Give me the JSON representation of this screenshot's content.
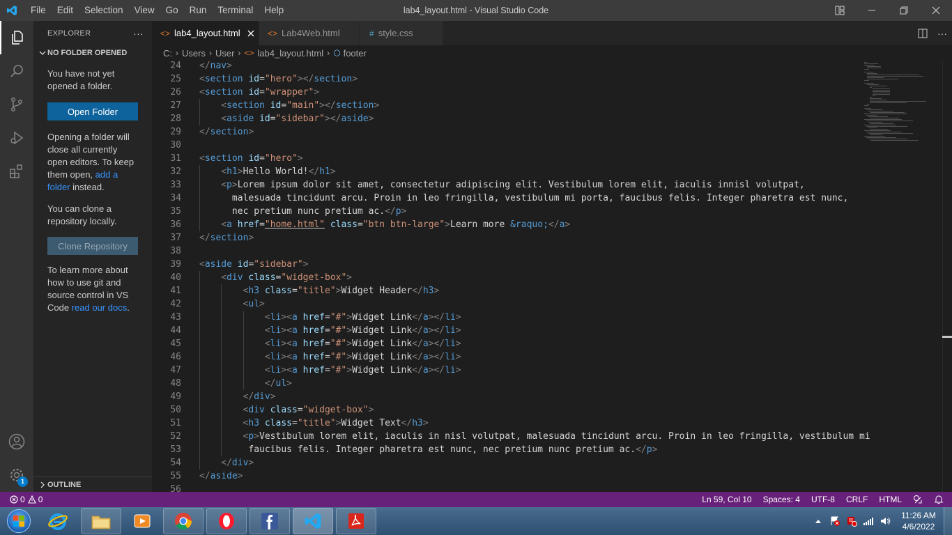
{
  "window": {
    "title": "lab4_layout.html - Visual Studio Code",
    "menu": [
      "File",
      "Edit",
      "Selection",
      "View",
      "Go",
      "Run",
      "Terminal",
      "Help"
    ]
  },
  "activity_bar": {
    "items": [
      "explorer-icon",
      "search-icon",
      "source-control-icon",
      "run-debug-icon",
      "extensions-icon",
      "account-icon",
      "settings-gear-icon"
    ],
    "settings_badge": "1"
  },
  "sidebar": {
    "title": "EXPLORER",
    "more": "···",
    "section": "NO FOLDER OPENED",
    "no_folder_text": "You have not yet opened a folder.",
    "open_folder_button": "Open Folder",
    "opening_text_before": "Opening a folder will close all currently open editors. To keep them open, ",
    "add_folder_link": "add a folder",
    "opening_text_after": " instead.",
    "clone_text": "You can clone a repository locally.",
    "clone_button": "Clone Repository",
    "learn_text": "To learn more about how to use git and source control in VS Code ",
    "docs_link": "read our docs",
    "learn_text_end": ".",
    "outline": "OUTLINE"
  },
  "tabs": [
    {
      "label": "lab4_layout.html",
      "icon": "html-icon",
      "active": true
    },
    {
      "label": "Lab4Web.html",
      "icon": "html-icon",
      "active": false
    },
    {
      "label": "style.css",
      "icon": "css-icon",
      "active": false
    }
  ],
  "breadcrumb": [
    "C:",
    "Users",
    "User",
    "lab4_layout.html",
    "footer"
  ],
  "editor": {
    "lines": [
      {
        "n": "24",
        "indent": 0,
        "tokens": [
          [
            "b",
            "</"
          ],
          [
            "t",
            "nav"
          ],
          [
            "b",
            ">"
          ]
        ]
      },
      {
        "n": "25",
        "indent": 0,
        "tokens": [
          [
            "b",
            "<"
          ],
          [
            "t",
            "section"
          ],
          [
            "p",
            " "
          ],
          [
            "a",
            "id"
          ],
          [
            "p",
            "="
          ],
          [
            "s",
            "\"hero\""
          ],
          [
            "b",
            "></"
          ],
          [
            "t",
            "section"
          ],
          [
            "b",
            ">"
          ]
        ]
      },
      {
        "n": "26",
        "indent": 0,
        "tokens": [
          [
            "b",
            "<"
          ],
          [
            "t",
            "section"
          ],
          [
            "p",
            " "
          ],
          [
            "a",
            "id"
          ],
          [
            "p",
            "="
          ],
          [
            "s",
            "\"wrapper\""
          ],
          [
            "b",
            ">"
          ]
        ]
      },
      {
        "n": "27",
        "indent": 1,
        "tokens": [
          [
            "b",
            "<"
          ],
          [
            "t",
            "section"
          ],
          [
            "p",
            " "
          ],
          [
            "a",
            "id"
          ],
          [
            "p",
            "="
          ],
          [
            "s",
            "\"main\""
          ],
          [
            "b",
            "></"
          ],
          [
            "t",
            "section"
          ],
          [
            "b",
            ">"
          ]
        ]
      },
      {
        "n": "28",
        "indent": 1,
        "tokens": [
          [
            "b",
            "<"
          ],
          [
            "t",
            "aside"
          ],
          [
            "p",
            " "
          ],
          [
            "a",
            "id"
          ],
          [
            "p",
            "="
          ],
          [
            "s",
            "\"sidebar\""
          ],
          [
            "b",
            "></"
          ],
          [
            "t",
            "aside"
          ],
          [
            "b",
            ">"
          ]
        ]
      },
      {
        "n": "29",
        "indent": 0,
        "tokens": [
          [
            "b",
            "</"
          ],
          [
            "t",
            "section"
          ],
          [
            "b",
            ">"
          ]
        ]
      },
      {
        "n": "30",
        "indent": 0,
        "tokens": []
      },
      {
        "n": "31",
        "indent": 0,
        "tokens": [
          [
            "b",
            "<"
          ],
          [
            "t",
            "section"
          ],
          [
            "p",
            " "
          ],
          [
            "a",
            "id"
          ],
          [
            "p",
            "="
          ],
          [
            "s",
            "\"hero\""
          ],
          [
            "b",
            ">"
          ]
        ]
      },
      {
        "n": "32",
        "indent": 1,
        "tokens": [
          [
            "b",
            "<"
          ],
          [
            "t",
            "h1"
          ],
          [
            "b",
            ">"
          ],
          [
            "p",
            "Hello World!"
          ],
          [
            "b",
            "</"
          ],
          [
            "t",
            "h1"
          ],
          [
            "b",
            ">"
          ]
        ]
      },
      {
        "n": "33",
        "indent": 1,
        "tokens": [
          [
            "b",
            "<"
          ],
          [
            "t",
            "p"
          ],
          [
            "b",
            ">"
          ],
          [
            "p",
            "Lorem ipsum dolor sit amet, consectetur adipiscing elit. Vestibulum lorem elit, iaculis innisl volutpat,"
          ]
        ]
      },
      {
        "n": "34",
        "indent": 1,
        "tokens": [
          [
            "p",
            "  malesuada tincidunt arcu. Proin in leo fringilla, vestibulum mi porta, faucibus felis. Integer pharetra est nunc,"
          ]
        ]
      },
      {
        "n": "35",
        "indent": 1,
        "tokens": [
          [
            "p",
            "  nec pretium nunc pretium ac."
          ],
          [
            "b",
            "</"
          ],
          [
            "t",
            "p"
          ],
          [
            "b",
            ">"
          ]
        ]
      },
      {
        "n": "36",
        "indent": 1,
        "tokens": [
          [
            "b",
            "<"
          ],
          [
            "t",
            "a"
          ],
          [
            "p",
            " "
          ],
          [
            "a",
            "href"
          ],
          [
            "p",
            "="
          ],
          [
            "su",
            "\"home.html\""
          ],
          [
            "p",
            " "
          ],
          [
            "a",
            "class"
          ],
          [
            "p",
            "="
          ],
          [
            "s",
            "\"btn btn-large\""
          ],
          [
            "b",
            ">"
          ],
          [
            "p",
            "Learn more "
          ],
          [
            "e",
            "&raquo;"
          ],
          [
            "b",
            "</"
          ],
          [
            "t",
            "a"
          ],
          [
            "b",
            ">"
          ]
        ]
      },
      {
        "n": "37",
        "indent": 0,
        "tokens": [
          [
            "b",
            "</"
          ],
          [
            "t",
            "section"
          ],
          [
            "b",
            ">"
          ]
        ]
      },
      {
        "n": "38",
        "indent": 0,
        "tokens": []
      },
      {
        "n": "39",
        "indent": 0,
        "tokens": [
          [
            "b",
            "<"
          ],
          [
            "t",
            "aside"
          ],
          [
            "p",
            " "
          ],
          [
            "a",
            "id"
          ],
          [
            "p",
            "="
          ],
          [
            "s",
            "\"sidebar\""
          ],
          [
            "b",
            ">"
          ]
        ]
      },
      {
        "n": "40",
        "indent": 1,
        "tokens": [
          [
            "b",
            "<"
          ],
          [
            "t",
            "div"
          ],
          [
            "p",
            " "
          ],
          [
            "a",
            "class"
          ],
          [
            "p",
            "="
          ],
          [
            "s",
            "\"widget-box\""
          ],
          [
            "b",
            ">"
          ]
        ]
      },
      {
        "n": "41",
        "indent": 2,
        "tokens": [
          [
            "b",
            "<"
          ],
          [
            "t",
            "h3"
          ],
          [
            "p",
            " "
          ],
          [
            "a",
            "class"
          ],
          [
            "p",
            "="
          ],
          [
            "s",
            "\"title\""
          ],
          [
            "b",
            ">"
          ],
          [
            "p",
            "Widget Header"
          ],
          [
            "b",
            "</"
          ],
          [
            "t",
            "h3"
          ],
          [
            "b",
            ">"
          ]
        ]
      },
      {
        "n": "42",
        "indent": 2,
        "tokens": [
          [
            "b",
            "<"
          ],
          [
            "t",
            "ul"
          ],
          [
            "b",
            ">"
          ]
        ]
      },
      {
        "n": "43",
        "indent": 3,
        "tokens": [
          [
            "b",
            "<"
          ],
          [
            "t",
            "li"
          ],
          [
            "b",
            "><"
          ],
          [
            "t",
            "a"
          ],
          [
            "p",
            " "
          ],
          [
            "a",
            "href"
          ],
          [
            "p",
            "="
          ],
          [
            "s",
            "\"#\""
          ],
          [
            "b",
            ">"
          ],
          [
            "p",
            "Widget Link"
          ],
          [
            "b",
            "</"
          ],
          [
            "t",
            "a"
          ],
          [
            "b",
            "></"
          ],
          [
            "t",
            "li"
          ],
          [
            "b",
            ">"
          ]
        ]
      },
      {
        "n": "44",
        "indent": 3,
        "tokens": [
          [
            "b",
            "<"
          ],
          [
            "t",
            "li"
          ],
          [
            "b",
            "><"
          ],
          [
            "t",
            "a"
          ],
          [
            "p",
            " "
          ],
          [
            "a",
            "href"
          ],
          [
            "p",
            "="
          ],
          [
            "s",
            "\"#\""
          ],
          [
            "b",
            ">"
          ],
          [
            "p",
            "Widget Link"
          ],
          [
            "b",
            "</"
          ],
          [
            "t",
            "a"
          ],
          [
            "b",
            "></"
          ],
          [
            "t",
            "li"
          ],
          [
            "b",
            ">"
          ]
        ]
      },
      {
        "n": "45",
        "indent": 3,
        "tokens": [
          [
            "b",
            "<"
          ],
          [
            "t",
            "li"
          ],
          [
            "b",
            "><"
          ],
          [
            "t",
            "a"
          ],
          [
            "p",
            " "
          ],
          [
            "a",
            "href"
          ],
          [
            "p",
            "="
          ],
          [
            "s",
            "\"#\""
          ],
          [
            "b",
            ">"
          ],
          [
            "p",
            "Widget Link"
          ],
          [
            "b",
            "</"
          ],
          [
            "t",
            "a"
          ],
          [
            "b",
            "></"
          ],
          [
            "t",
            "li"
          ],
          [
            "b",
            ">"
          ]
        ]
      },
      {
        "n": "46",
        "indent": 3,
        "tokens": [
          [
            "b",
            "<"
          ],
          [
            "t",
            "li"
          ],
          [
            "b",
            "><"
          ],
          [
            "t",
            "a"
          ],
          [
            "p",
            " "
          ],
          [
            "a",
            "href"
          ],
          [
            "p",
            "="
          ],
          [
            "s",
            "\"#\""
          ],
          [
            "b",
            ">"
          ],
          [
            "p",
            "Widget Link"
          ],
          [
            "b",
            "</"
          ],
          [
            "t",
            "a"
          ],
          [
            "b",
            "></"
          ],
          [
            "t",
            "li"
          ],
          [
            "b",
            ">"
          ]
        ]
      },
      {
        "n": "47",
        "indent": 3,
        "tokens": [
          [
            "b",
            "<"
          ],
          [
            "t",
            "li"
          ],
          [
            "b",
            "><"
          ],
          [
            "t",
            "a"
          ],
          [
            "p",
            " "
          ],
          [
            "a",
            "href"
          ],
          [
            "p",
            "="
          ],
          [
            "s",
            "\"#\""
          ],
          [
            "b",
            ">"
          ],
          [
            "p",
            "Widget Link"
          ],
          [
            "b",
            "</"
          ],
          [
            "t",
            "a"
          ],
          [
            "b",
            "></"
          ],
          [
            "t",
            "li"
          ],
          [
            "b",
            ">"
          ]
        ]
      },
      {
        "n": "48",
        "indent": 3,
        "tokens": [
          [
            "b",
            "</"
          ],
          [
            "t",
            "ul"
          ],
          [
            "b",
            ">"
          ]
        ]
      },
      {
        "n": "49",
        "indent": 2,
        "tokens": [
          [
            "b",
            "</"
          ],
          [
            "t",
            "div"
          ],
          [
            "b",
            ">"
          ]
        ]
      },
      {
        "n": "50",
        "indent": 2,
        "tokens": [
          [
            "b",
            "<"
          ],
          [
            "t",
            "div"
          ],
          [
            "p",
            " "
          ],
          [
            "a",
            "class"
          ],
          [
            "p",
            "="
          ],
          [
            "s",
            "\"widget-box\""
          ],
          [
            "b",
            ">"
          ]
        ]
      },
      {
        "n": "51",
        "indent": 2,
        "tokens": [
          [
            "b",
            "<"
          ],
          [
            "t",
            "h3"
          ],
          [
            "p",
            " "
          ],
          [
            "a",
            "class"
          ],
          [
            "p",
            "="
          ],
          [
            "s",
            "\"title\""
          ],
          [
            "b",
            ">"
          ],
          [
            "p",
            "Widget Text"
          ],
          [
            "b",
            "</"
          ],
          [
            "t",
            "h3"
          ],
          [
            "b",
            ">"
          ]
        ]
      },
      {
        "n": "52",
        "indent": 2,
        "tokens": [
          [
            "b",
            "<"
          ],
          [
            "t",
            "p"
          ],
          [
            "b",
            ">"
          ],
          [
            "p",
            "Vestibulum lorem elit, iaculis in nisl volutpat, malesuada tincidunt arcu. Proin in leo fringilla, vestibulum mi"
          ]
        ]
      },
      {
        "n": "53",
        "indent": 2,
        "tokens": [
          [
            "p",
            " faucibus felis. Integer pharetra est nunc, nec pretium nunc pretium ac."
          ],
          [
            "b",
            "</"
          ],
          [
            "t",
            "p"
          ],
          [
            "b",
            ">"
          ]
        ]
      },
      {
        "n": "54",
        "indent": 1,
        "tokens": [
          [
            "b",
            "</"
          ],
          [
            "t",
            "div"
          ],
          [
            "b",
            ">"
          ]
        ]
      },
      {
        "n": "55",
        "indent": 0,
        "tokens": [
          [
            "b",
            "</"
          ],
          [
            "t",
            "aside"
          ],
          [
            "b",
            ">"
          ]
        ]
      },
      {
        "n": "56",
        "indent": 0,
        "tokens": []
      }
    ]
  },
  "status": {
    "errors": "0",
    "warnings": "0",
    "position": "Ln 59, Col 10",
    "spaces": "Spaces: 4",
    "encoding": "UTF-8",
    "eol": "CRLF",
    "language": "HTML"
  },
  "taskbar": {
    "apps": [
      "internet-explorer-icon",
      "file-explorer-icon",
      "media-player-icon",
      "chrome-icon",
      "opera-icon",
      "facebook-icon",
      "vscode-icon",
      "acrobat-icon"
    ],
    "time": "11:26 AM",
    "date": "4/6/2022"
  },
  "colors": {
    "titlebar": "#3c3c3c",
    "activitybar": "#333333",
    "sidebar": "#252526",
    "editor": "#1e1e1e",
    "statusbar": "#68217a",
    "primary_button": "#0e639c",
    "link": "#3794ff"
  }
}
